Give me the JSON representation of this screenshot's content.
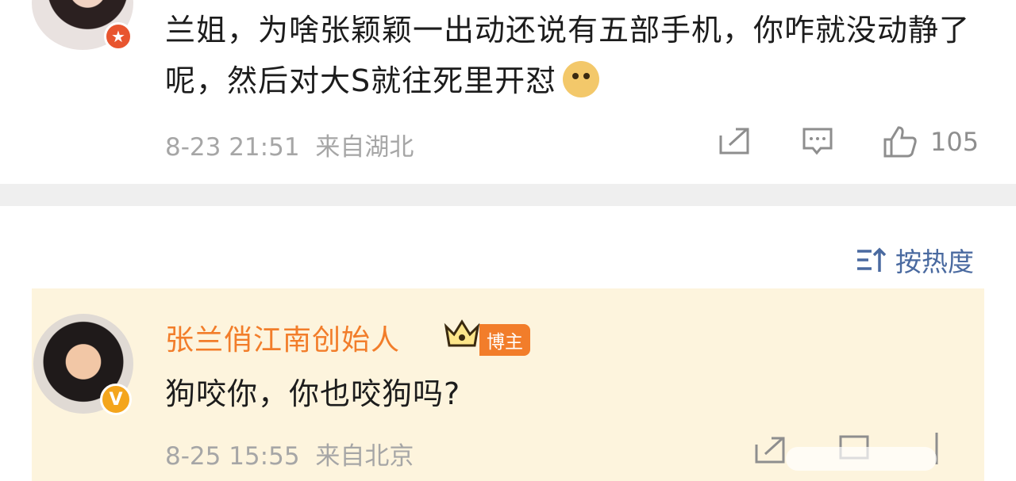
{
  "comment1": {
    "text": "兰姐，为啥张颖颖一出动还说有五部手机，你咋就没动静了呢，然后对大S就往死里开怼",
    "emoji": "doge-emoji",
    "date": "8-23 21:51",
    "location": "来自湖北",
    "likes": "105",
    "badge": "red-star-badge"
  },
  "sort": {
    "label": "按热度",
    "icon": "sort-icon"
  },
  "comment2": {
    "author": "张兰俏江南创始人",
    "tag": "博主",
    "text": "狗咬你，你也咬狗吗?",
    "date": "8-25 15:55",
    "location": "来自北京",
    "badge": "verified-v-badge",
    "crown": "crown-icon"
  },
  "colors": {
    "author": "#f27d2a",
    "link": "#4a6aa0",
    "highlight_bg": "#fdf4dd",
    "meta": "#a6a6a6"
  }
}
